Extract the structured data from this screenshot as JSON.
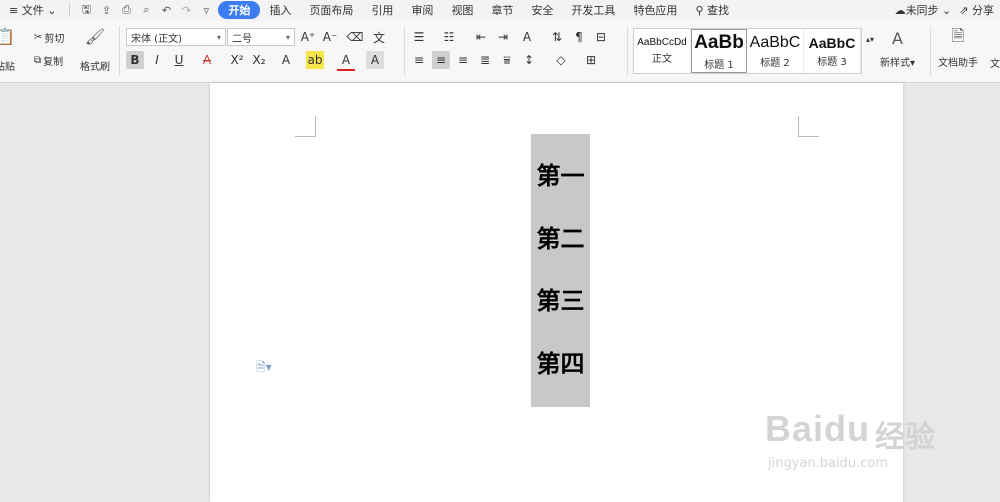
{
  "menubar": {
    "file": "文件",
    "tabs": [
      "开始",
      "插入",
      "页面布局",
      "引用",
      "审阅",
      "视图",
      "章节",
      "安全",
      "开发工具",
      "特色应用"
    ],
    "search": "查找",
    "sync": "未同步",
    "share": "分享",
    "active_tab_color": "#3b7cf0"
  },
  "ribbon": {
    "paste": "粘贴",
    "cut": "剪切",
    "copy": "复制",
    "format_painter": "格式刷",
    "font_name": "宋体 (正文)",
    "font_size": "二号",
    "styles": [
      {
        "preview": "AaBbCcDd",
        "name": "正文"
      },
      {
        "preview": "AaBb",
        "name": "标题 1"
      },
      {
        "preview": "AaBbC",
        "name": "标题 2"
      },
      {
        "preview": "AaBbC",
        "name": "标题 3"
      }
    ],
    "new_style": "新样式",
    "doc_assistant": "文档助手",
    "cutoff_label": "文"
  },
  "document": {
    "lines": [
      "第一",
      "第二",
      "第三",
      "第四"
    ],
    "highlight_color": "#c8c8c8"
  },
  "watermark": {
    "brand": "Baidu",
    "cn": "经验",
    "url": "jingyan.baidu.com"
  }
}
